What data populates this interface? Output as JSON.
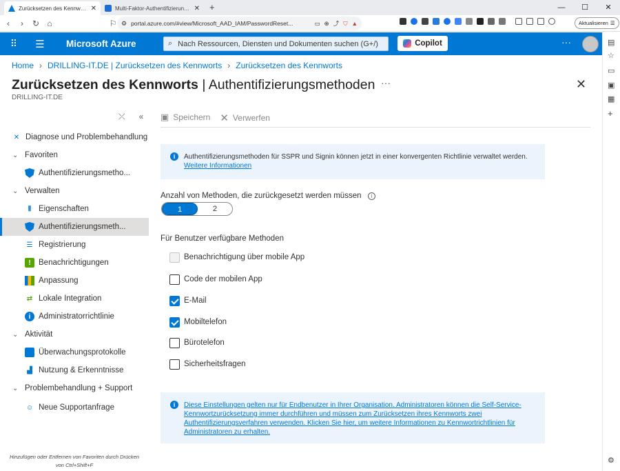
{
  "browser": {
    "tabs": [
      {
        "title": "Zurücksetzen des Kennworts - Microsoft Azure",
        "active": true
      },
      {
        "title": "Multi-Faktor-Authentifizierung pro Benutzer",
        "active": false
      }
    ],
    "url": "portal.azure.com/#view/Microsoft_AAD_IAM/PasswordReset...",
    "update_label": "Aktualisieren"
  },
  "azure": {
    "brand": "Microsoft Azure",
    "search_placeholder": "Nach Ressourcen, Diensten und Dokumenten suchen (G+/)",
    "copilot_label": "Copilot"
  },
  "breadcrumb": [
    "Home",
    "DRILLING-IT.DE | Zurücksetzen des Kennworts",
    "Zurücksetzen des Kennworts"
  ],
  "page": {
    "title_bold": "Zurücksetzen des Kennworts",
    "title_rest": " | Authentifizierungsmethoden",
    "subtitle": "DRILLING-IT.DE"
  },
  "nav": {
    "items": [
      {
        "label": "Diagnose und Problembehandlung",
        "type": "item",
        "icon": "wrench-icon"
      },
      {
        "label": "Favoriten",
        "type": "group"
      },
      {
        "label": "Authentifizierungsmetho...",
        "type": "sub",
        "icon": "shield-icon"
      },
      {
        "label": "Verwalten",
        "type": "group"
      },
      {
        "label": "Eigenschaften",
        "type": "sub",
        "icon": "properties-icon"
      },
      {
        "label": "Authentifizierungsmeth...",
        "type": "sub",
        "icon": "shield-icon",
        "selected": true
      },
      {
        "label": "Registrierung",
        "type": "sub",
        "icon": "list-icon"
      },
      {
        "label": "Benachrichtigungen",
        "type": "sub",
        "icon": "notification-icon"
      },
      {
        "label": "Anpassung",
        "type": "sub",
        "icon": "customize-icon"
      },
      {
        "label": "Lokale Integration",
        "type": "sub",
        "icon": "sync-icon"
      },
      {
        "label": "Administratorrichtlinie",
        "type": "sub",
        "icon": "info-icon"
      },
      {
        "label": "Aktivität",
        "type": "group"
      },
      {
        "label": "Überwachungsprotokolle",
        "type": "sub",
        "icon": "log-icon"
      },
      {
        "label": "Nutzung & Erkenntnisse",
        "type": "sub",
        "icon": "chart-icon"
      },
      {
        "label": "Problembehandlung + Support",
        "type": "group"
      },
      {
        "label": "Neue Supportanfrage",
        "type": "sub",
        "icon": "support-icon"
      }
    ],
    "footer": "Hinzufügen oder Entfernen von Favoriten durch Drücken von Ctrl+Shift+F"
  },
  "toolbar": {
    "save": "Speichern",
    "discard": "Verwerfen"
  },
  "info_top": {
    "text": "Authentifizierungsmethoden für SSPR und Signin können jetzt in einer konvergenten Richtlinie verwaltet werden.",
    "link": "Weitere Informationen"
  },
  "methods_count": {
    "label": "Anzahl von Methoden, die zurückgesetzt werden müssen",
    "options": [
      "1",
      "2"
    ],
    "selected": "1"
  },
  "available_methods": {
    "label": "Für Benutzer verfügbare Methoden",
    "items": [
      {
        "label": "Benachrichtigung über mobile App",
        "checked": false,
        "disabled": true
      },
      {
        "label": "Code der mobilen App",
        "checked": false,
        "disabled": false
      },
      {
        "label": "E-Mail",
        "checked": true,
        "disabled": false
      },
      {
        "label": "Mobiltelefon",
        "checked": true,
        "disabled": false
      },
      {
        "label": "Bürotelefon",
        "checked": false,
        "disabled": false
      },
      {
        "label": "Sicherheitsfragen",
        "checked": false,
        "disabled": false
      }
    ]
  },
  "info_bottom": {
    "text": "Diese Einstellungen gelten nur für Endbenutzer in Ihrer Organisation. Administratoren können die Self-Service-Kennwortzurücksetzung immer durchführen und müssen zum Zurücksetzen ihres Kennworts zwei Authentifizierungsverfahren verwenden. Klicken Sie hier, um weitere Informationen zu Kennwortrichtlinien für Administratoren zu erhalten."
  },
  "colors": {
    "accent": "#0078d4",
    "selected_nav": "#e1dfdd",
    "info_bg": "#ebf3fc"
  }
}
